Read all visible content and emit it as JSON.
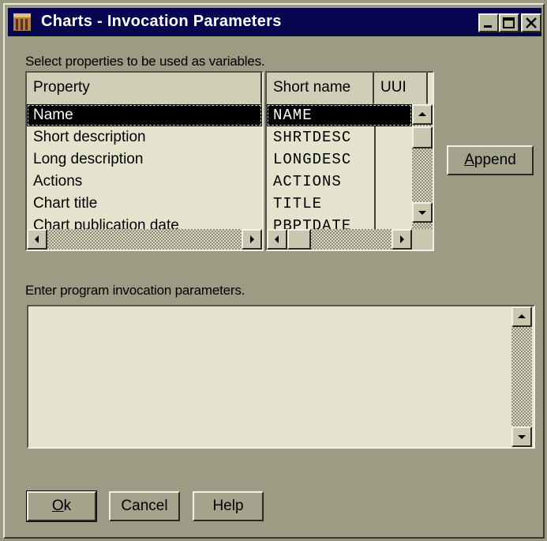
{
  "window": {
    "title": "Charts - Invocation Parameters"
  },
  "properties_label": "Select properties to be used as variables.",
  "properties_list": {
    "header": "Property",
    "items": [
      "Name",
      "Short description",
      "Long description",
      "Actions",
      "Chart title",
      "Chart publication date"
    ],
    "selected_index": 0
  },
  "shortname_list": {
    "headers": [
      "Short name",
      "UUI"
    ],
    "items": [
      "NAME",
      "SHRTDESC",
      "LONGDESC",
      "ACTIONS",
      "TITLE",
      "PBPTDATE"
    ],
    "selected_index": 0
  },
  "append_button": {
    "mnemonic": "A",
    "rest": "ppend"
  },
  "params_label": "Enter program invocation parameters.",
  "params_value": "",
  "buttons": {
    "ok": {
      "mnemonic": "O",
      "rest": "k"
    },
    "cancel": "Cancel",
    "help": "Help"
  }
}
